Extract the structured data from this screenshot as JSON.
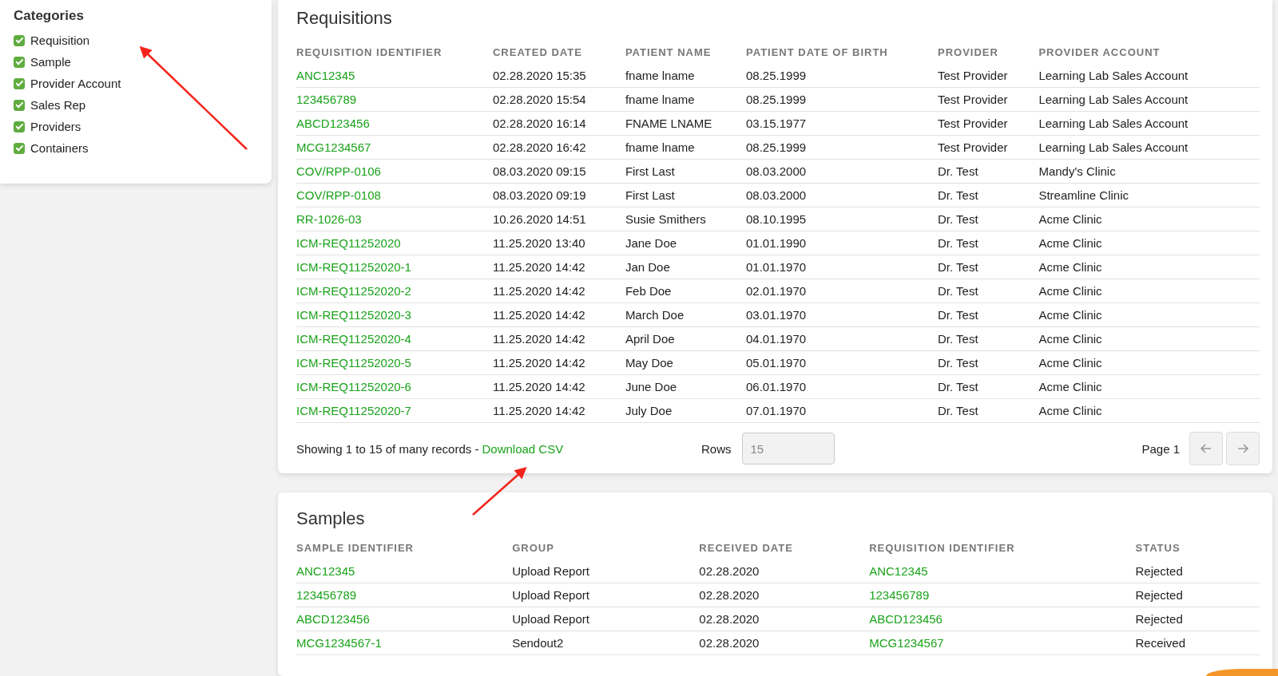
{
  "categories": {
    "title": "Categories",
    "items": [
      {
        "label": "Requisition",
        "checked": true
      },
      {
        "label": "Sample",
        "checked": true
      },
      {
        "label": "Provider Account",
        "checked": true
      },
      {
        "label": "Sales Rep",
        "checked": true
      },
      {
        "label": "Providers",
        "checked": true
      },
      {
        "label": "Containers",
        "checked": true
      }
    ]
  },
  "requisitions": {
    "title": "Requisitions",
    "columns": [
      "REQUISITION IDENTIFIER",
      "CREATED DATE",
      "PATIENT NAME",
      "PATIENT DATE OF BIRTH",
      "PROVIDER",
      "PROVIDER ACCOUNT"
    ],
    "rows": [
      [
        "ANC12345",
        "02.28.2020 15:35",
        "fname lname",
        "08.25.1999",
        "Test Provider",
        "Learning Lab Sales Account"
      ],
      [
        "123456789",
        "02.28.2020 15:54",
        "fname lname",
        "08.25.1999",
        "Test Provider",
        "Learning Lab Sales Account"
      ],
      [
        "ABCD123456",
        "02.28.2020 16:14",
        "FNAME LNAME",
        "03.15.1977",
        "Test Provider",
        "Learning Lab Sales Account"
      ],
      [
        "MCG1234567",
        "02.28.2020 16:42",
        "fname lname",
        "08.25.1999",
        "Test Provider",
        "Learning Lab Sales Account"
      ],
      [
        "COV/RPP-0106",
        "08.03.2020 09:15",
        "First Last",
        "08.03.2000",
        "Dr. Test",
        "Mandy's Clinic"
      ],
      [
        "COV/RPP-0108",
        "08.03.2020 09:19",
        "First Last",
        "08.03.2000",
        "Dr. Test",
        "Streamline Clinic"
      ],
      [
        "RR-1026-03",
        "10.26.2020 14:51",
        "Susie Smithers",
        "08.10.1995",
        "Dr. Test",
        "Acme Clinic"
      ],
      [
        "ICM-REQ11252020",
        "11.25.2020 13:40",
        "Jane Doe",
        "01.01.1990",
        "Dr. Test",
        "Acme Clinic"
      ],
      [
        "ICM-REQ11252020-1",
        "11.25.2020 14:42",
        "Jan Doe",
        "01.01.1970",
        "Dr. Test",
        "Acme Clinic"
      ],
      [
        "ICM-REQ11252020-2",
        "11.25.2020 14:42",
        "Feb Doe",
        "02.01.1970",
        "Dr. Test",
        "Acme Clinic"
      ],
      [
        "ICM-REQ11252020-3",
        "11.25.2020 14:42",
        "March Doe",
        "03.01.1970",
        "Dr. Test",
        "Acme Clinic"
      ],
      [
        "ICM-REQ11252020-4",
        "11.25.2020 14:42",
        "April Doe",
        "04.01.1970",
        "Dr. Test",
        "Acme Clinic"
      ],
      [
        "ICM-REQ11252020-5",
        "11.25.2020 14:42",
        "May Doe",
        "05.01.1970",
        "Dr. Test",
        "Acme Clinic"
      ],
      [
        "ICM-REQ11252020-6",
        "11.25.2020 14:42",
        "June Doe",
        "06.01.1970",
        "Dr. Test",
        "Acme Clinic"
      ],
      [
        "ICM-REQ11252020-7",
        "11.25.2020 14:42",
        "July Doe",
        "07.01.1970",
        "Dr. Test",
        "Acme Clinic"
      ]
    ],
    "footer": {
      "summary": "Showing 1 to 15 of many records -",
      "download_link": "Download CSV",
      "rows_label": "Rows",
      "rows_value": "15",
      "page_label": "Page 1",
      "prev_disabled": true,
      "next_disabled": true
    }
  },
  "samples": {
    "title": "Samples",
    "columns": [
      "SAMPLE IDENTIFIER",
      "GROUP",
      "RECEIVED DATE",
      "REQUISITION IDENTIFIER",
      "STATUS"
    ],
    "rows": [
      [
        "ANC12345",
        "Upload Report",
        "02.28.2020",
        "ANC12345",
        "Rejected"
      ],
      [
        "123456789",
        "Upload Report",
        "02.28.2020",
        "123456789",
        "Rejected"
      ],
      [
        "ABCD123456",
        "Upload Report",
        "02.28.2020",
        "ABCD123456",
        "Rejected"
      ],
      [
        "MCG1234567-1",
        "Sendout2",
        "02.28.2020",
        "MCG1234567",
        "Received"
      ]
    ]
  }
}
